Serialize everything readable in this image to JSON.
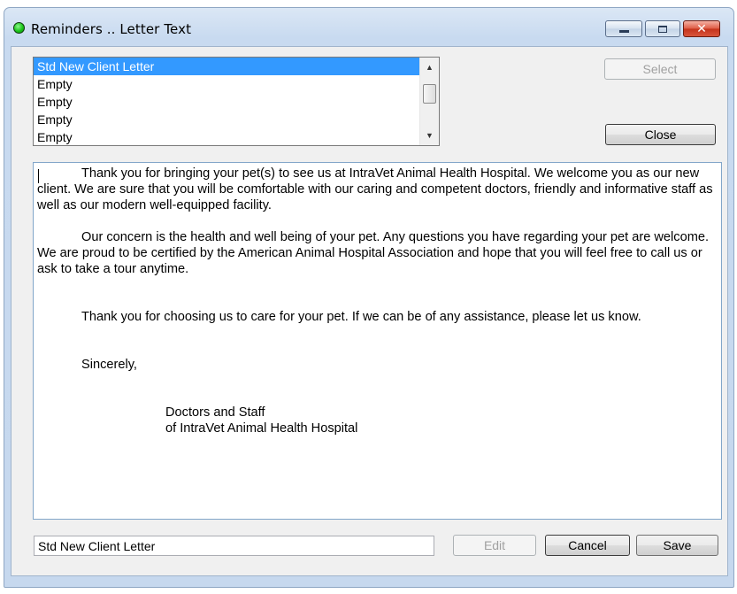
{
  "window": {
    "title": "Reminders .. Letter Text",
    "status_color": "#19c419",
    "controls": {
      "minimize": "minimize-icon",
      "maximize": "maximize-icon",
      "close_glyph": "✕"
    }
  },
  "letters_list": {
    "items": [
      {
        "label": "Std New Client Letter",
        "selected": true
      },
      {
        "label": "Empty",
        "selected": false
      },
      {
        "label": "Empty",
        "selected": false
      },
      {
        "label": "Empty",
        "selected": false
      },
      {
        "label": "Empty",
        "selected": false
      }
    ],
    "scroll_up": "▲",
    "scroll_down": "▼"
  },
  "buttons": {
    "select": "Select",
    "close": "Close",
    "edit": "Edit",
    "cancel": "Cancel",
    "save": "Save"
  },
  "letter": {
    "paragraph1": "Thank you for bringing your pet(s) to see us at IntraVet Animal Health Hospital.  We welcome you as our new client.  We are sure that you will be comfortable with our caring and competent doctors, friendly and informative staff as well as our modern well-equipped facility.",
    "paragraph2": "Our concern is the health and well being of your pet.  Any questions you have regarding your pet are welcome.  We are proud to be certified by the American Animal Hospital Association and hope that you will feel free to call us or ask to take a tour anytime.",
    "paragraph3": "Thank you for choosing us to care for your pet.  If we can be of any assistance, please let us know.",
    "closing": "Sincerely,",
    "signature_line1": "Doctors and Staff",
    "signature_line2": "of IntraVet Animal Health Hospital"
  },
  "letter_name": {
    "value": "Std New Client Letter"
  }
}
